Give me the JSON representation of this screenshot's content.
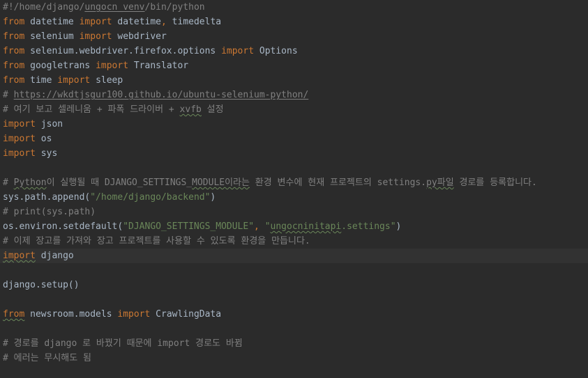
{
  "editor": {
    "lines": [
      {
        "segments": [
          {
            "t": "#!/home/django/",
            "c": "cm"
          },
          {
            "t": "ungocn_venv",
            "c": "cm ul-plain"
          },
          {
            "t": "/bin/python",
            "c": "cm"
          }
        ]
      },
      {
        "segments": [
          {
            "t": "from",
            "c": "kw"
          },
          {
            "t": " datetime ",
            "c": "id"
          },
          {
            "t": "import",
            "c": "kw"
          },
          {
            "t": " datetime",
            "c": "id"
          },
          {
            "t": ",",
            "c": "kw"
          },
          {
            "t": " timedelta",
            "c": "id"
          }
        ]
      },
      {
        "segments": [
          {
            "t": "from",
            "c": "kw"
          },
          {
            "t": " selenium ",
            "c": "id"
          },
          {
            "t": "import",
            "c": "kw"
          },
          {
            "t": " webdriver",
            "c": "id"
          }
        ]
      },
      {
        "segments": [
          {
            "t": "from",
            "c": "kw"
          },
          {
            "t": " selenium.webdriver.firefox.options ",
            "c": "id"
          },
          {
            "t": "import",
            "c": "kw"
          },
          {
            "t": " Options",
            "c": "id"
          }
        ]
      },
      {
        "segments": [
          {
            "t": "from",
            "c": "kw"
          },
          {
            "t": " googletrans ",
            "c": "id"
          },
          {
            "t": "import",
            "c": "kw"
          },
          {
            "t": " Translator",
            "c": "id"
          }
        ]
      },
      {
        "segments": [
          {
            "t": "from",
            "c": "kw"
          },
          {
            "t": " time ",
            "c": "id"
          },
          {
            "t": "import",
            "c": "kw"
          },
          {
            "t": " sleep",
            "c": "id"
          }
        ]
      },
      {
        "segments": [
          {
            "t": "# ",
            "c": "cm"
          },
          {
            "t": "https://wkdtjsgur100.github.io/ubuntu-selenium-python/",
            "c": "cm ul-plain"
          }
        ]
      },
      {
        "segments": [
          {
            "t": "# 여기 보고 셀레니움 + 파폭 드라이버 + ",
            "c": "cm"
          },
          {
            "t": "xvfb",
            "c": "cm ul"
          },
          {
            "t": " 설정",
            "c": "cm"
          }
        ]
      },
      {
        "segments": [
          {
            "t": "import",
            "c": "kw"
          },
          {
            "t": " json",
            "c": "id"
          }
        ]
      },
      {
        "segments": [
          {
            "t": "import",
            "c": "kw"
          },
          {
            "t": " os",
            "c": "id"
          }
        ]
      },
      {
        "segments": [
          {
            "t": "import",
            "c": "kw"
          },
          {
            "t": " sys",
            "c": "id"
          }
        ]
      },
      {
        "segments": []
      },
      {
        "segments": [
          {
            "t": "# ",
            "c": "cm"
          },
          {
            "t": "Python",
            "c": "cm ul"
          },
          {
            "t": "이 실행될 때 DJANGO_SETTINGS_",
            "c": "cm"
          },
          {
            "t": "MODULE이라는",
            "c": "cm ul"
          },
          {
            "t": " 환경 변수에 현재 프로젝트의 settings.",
            "c": "cm"
          },
          {
            "t": "py파일",
            "c": "cm ul"
          },
          {
            "t": " 경로를 등록합니다.",
            "c": "cm"
          }
        ]
      },
      {
        "segments": [
          {
            "t": "sys.path.append(",
            "c": "id"
          },
          {
            "t": "\"/home/django/backend\"",
            "c": "str"
          },
          {
            "t": ")",
            "c": "id"
          }
        ]
      },
      {
        "segments": [
          {
            "t": "# print(sys.path)",
            "c": "cm"
          }
        ]
      },
      {
        "segments": [
          {
            "t": "os.environ.setdefault(",
            "c": "id"
          },
          {
            "t": "\"DJANGO_SETTINGS_MODULE\"",
            "c": "str"
          },
          {
            "t": ", ",
            "c": "kw"
          },
          {
            "t": "\"",
            "c": "str"
          },
          {
            "t": "ungocninitapi",
            "c": "str ul"
          },
          {
            "t": ".settings\"",
            "c": "str"
          },
          {
            "t": ")",
            "c": "id"
          }
        ]
      },
      {
        "segments": [
          {
            "t": "# 이제 장고를 가져와 장고 프로젝트를 사용할 수 있도록 환경을 만듭니다.",
            "c": "cm"
          }
        ]
      },
      {
        "current": true,
        "segments": [
          {
            "t": "import",
            "c": "kw ul"
          },
          {
            "t": " django",
            "c": "id"
          }
        ]
      },
      {
        "segments": []
      },
      {
        "segments": [
          {
            "t": "django.setup()",
            "c": "id"
          }
        ]
      },
      {
        "segments": []
      },
      {
        "segments": [
          {
            "t": "from",
            "c": "kw ul"
          },
          {
            "t": " newsroom.models ",
            "c": "id"
          },
          {
            "t": "import",
            "c": "kw"
          },
          {
            "t": " CrawlingData",
            "c": "id"
          }
        ]
      },
      {
        "segments": []
      },
      {
        "segments": [
          {
            "t": "# 경로를 django 로 바꿨기 때문에 import 경로도 바뀜",
            "c": "cm"
          }
        ]
      },
      {
        "segments": [
          {
            "t": "# 에러는 무시해도 됨",
            "c": "cm"
          }
        ]
      }
    ]
  }
}
